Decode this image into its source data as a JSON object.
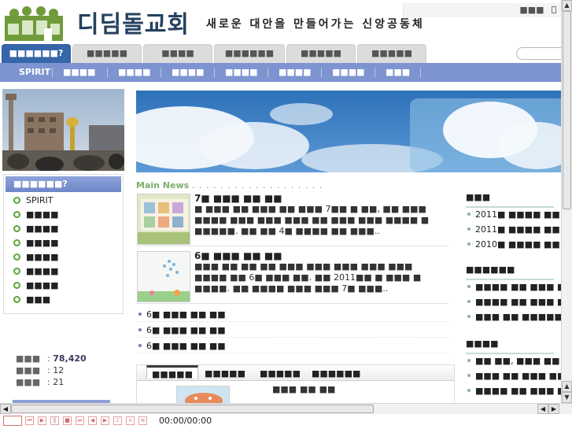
{
  "header": {
    "logo_text": "디딤돌교회",
    "slogan": "새로운 대안을 만들어가는 신앙공동체",
    "top_links": "■■■"
  },
  "tabs": [
    {
      "label": "■■■■■■?",
      "active": true
    },
    {
      "label": "■■■■■",
      "active": false
    },
    {
      "label": "■■■■",
      "active": false
    },
    {
      "label": "■■■■■■",
      "active": false
    },
    {
      "label": "■■■■■",
      "active": false
    },
    {
      "label": "■■■■■",
      "active": false
    }
  ],
  "subnav": [
    "SPIRIT",
    "■■■■",
    "■■■■",
    "■■■■",
    "■■■■",
    "■■■■",
    "■■■■",
    "■■■"
  ],
  "left_menu": {
    "title": "■■■■■■?",
    "items": [
      "SPIRIT",
      "■■■■",
      "■■■■",
      "■■■■",
      "■■■■",
      "■■■■",
      "■■■■",
      "■■■"
    ]
  },
  "stats": [
    {
      "label": "■■■",
      "value": "78,420",
      "strong": true
    },
    {
      "label": "■■■",
      "value": "12",
      "strong": false
    },
    {
      "label": "■■■",
      "value": "21",
      "strong": false
    }
  ],
  "main_news": {
    "heading": "Main News",
    "dots": ". . . . . . . . . . . . . . . . . . .",
    "items": [
      {
        "title": "7■ ■■■ ■■ ■■",
        "body": "■ ■■■ ■■ ■■■ ■■ ■■■ 7■■ ■ ■■, ■■ ■■■ ■■■■ ■■■ ■■■ ■■■ ■■ ■■■ ■■■ ■■■■ ■ ■■■■■. ■■ ■■ 4■ ■■■■ ■■ ■■■.."
      },
      {
        "title": "6■ ■■■ ■■ ■■",
        "body": "■■■ ■■ ■■ ■■ ■■■ ■■■ ■■■ ■■■ ■■■ ■■■■ ■■ 6■ ■■■ ■■. ■■ 2011■■ ■ ■■■ ■ ■■■■. ■■ ■■■■ ■■■ ■■■ 7■ ■■■.."
      }
    ],
    "list": [
      "6■ ■■■ ■■ ■■",
      "6■ ■■■ ■■ ■■",
      "6■ ■■■ ■■ ■■"
    ]
  },
  "right": {
    "sections": [
      {
        "title": "■■■",
        "rows": [
          "2011■ ■■■■ ■■ ■",
          "2011■ ■■■■ ■■ ■",
          "2010■ ■■■■ ■■ ■"
        ]
      },
      {
        "title": "■■■■■■",
        "rows": [
          "■■■■ ■■ ■■■ ■■",
          "■■■■ ■■ ■■■ ■■",
          "■■■ ■■ ■■■■■■"
        ]
      },
      {
        "title": "■■■■",
        "rows": [
          "■■ ■■, ■■■ ■■",
          "■■■ ■■ ■■■ ■■",
          "■■■■ ■■ ■■■ ■■"
        ]
      }
    ]
  },
  "bottom_tabs": {
    "tabs": [
      "■■■■■",
      "■■■■■",
      "■■■■■",
      "■■■■■■"
    ],
    "text": "■■■ ■■ ■■"
  },
  "media": {
    "time": "00:00/00:00"
  },
  "colors": {
    "primary_tab": "#3566aa",
    "subnav": "#7e94d0",
    "accent_green": "#7cae6c",
    "menu_bullet": "#5aa63a"
  }
}
